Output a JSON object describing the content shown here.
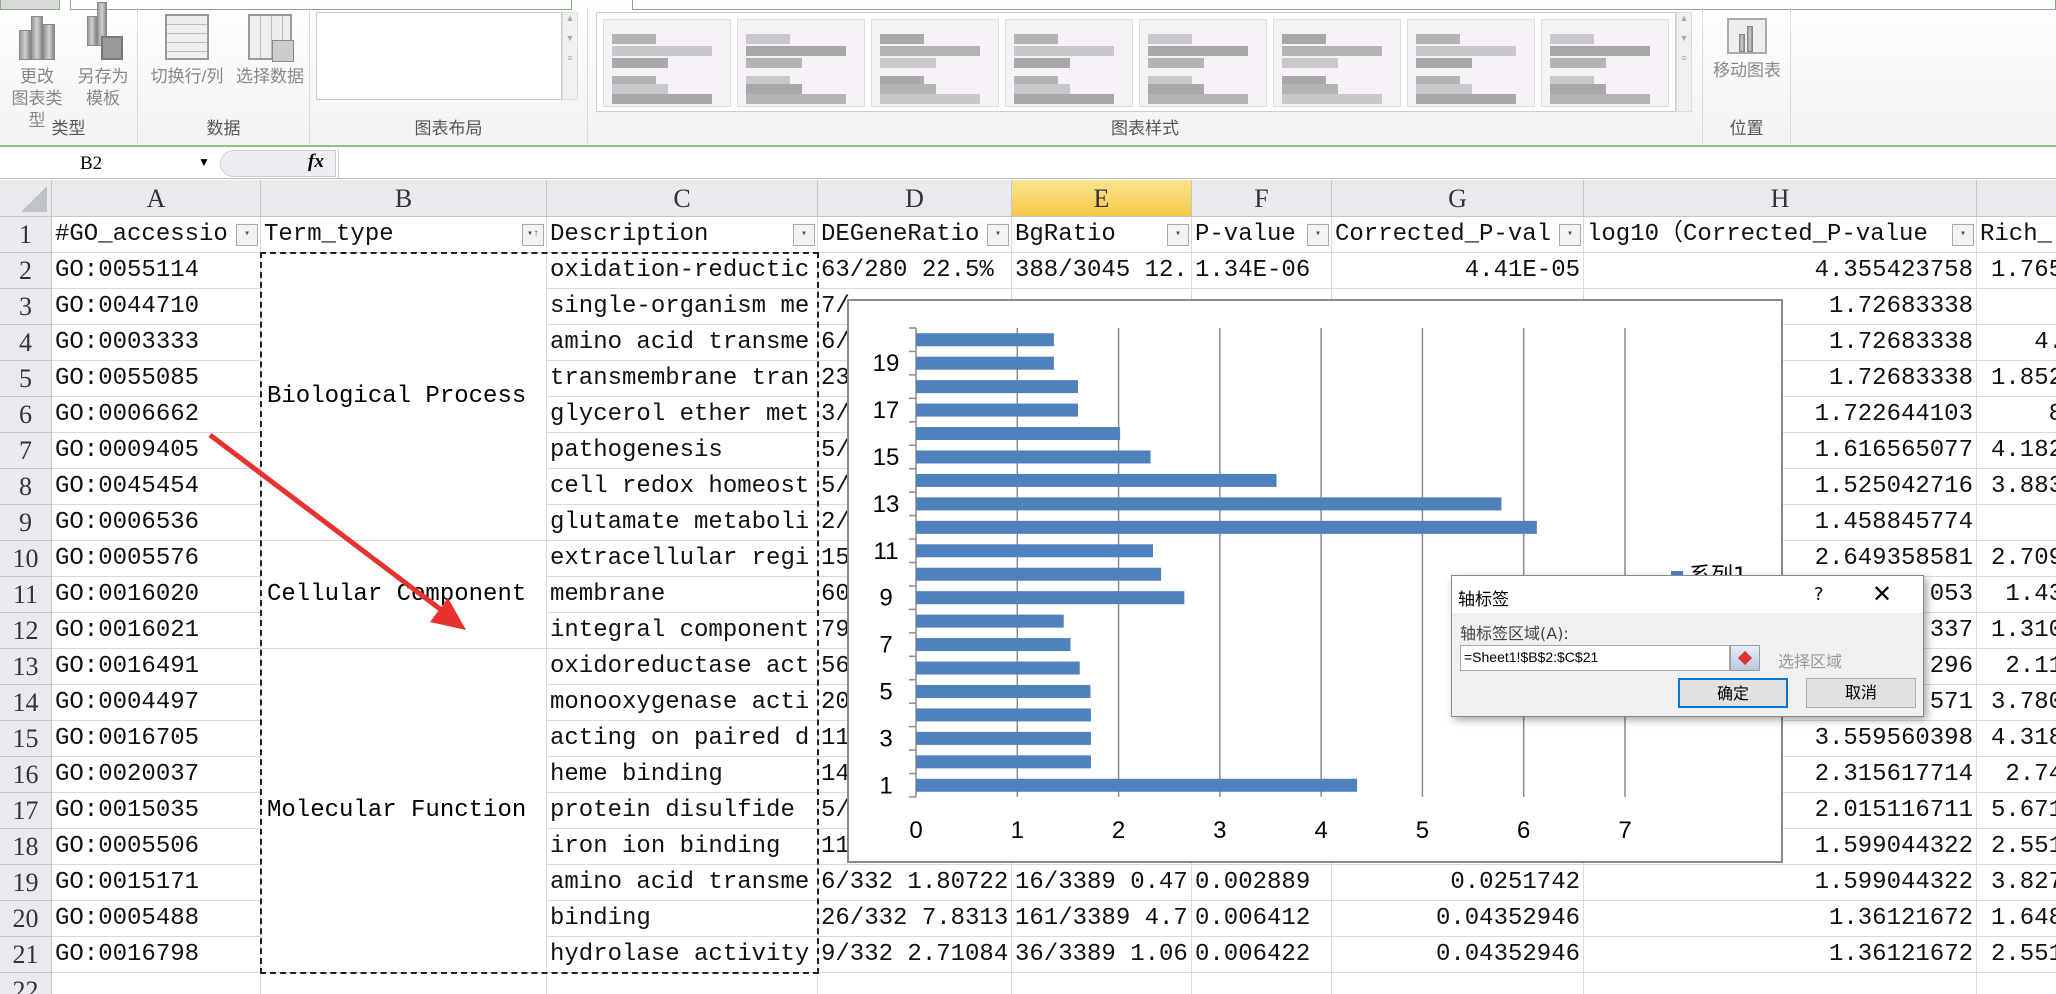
{
  "ribbon": {
    "groups": [
      {
        "label": "类型",
        "buttons": [
          {
            "line1": "更改",
            "line2": "图表类型",
            "icon": "chart-type-icon"
          },
          {
            "line1": "另存为",
            "line2": "模板",
            "icon": "save-template-icon"
          }
        ]
      },
      {
        "label": "数据",
        "buttons": [
          {
            "line1": "切换行/列",
            "line2": "",
            "icon": "switch-row-column-icon"
          },
          {
            "line1": "选择数据",
            "line2": "",
            "icon": "select-data-icon"
          }
        ]
      },
      {
        "label": "图表布局"
      },
      {
        "label": "图表样式"
      },
      {
        "label": "位置",
        "buttons": [
          {
            "line1": "移动图表",
            "line2": "",
            "icon": "move-chart-icon"
          }
        ]
      }
    ]
  },
  "formula_bar": {
    "name_box": "B2",
    "fx": "fx",
    "formula": ""
  },
  "columns": [
    "A",
    "B",
    "C",
    "D",
    "E",
    "F",
    "G",
    "H",
    ""
  ],
  "selected_column": "E",
  "header_row": [
    "#GO_accessio",
    "Term_type",
    "Description",
    "DEGeneRatio",
    "BgRatio",
    "P-value",
    "Corrected_P-val",
    "log10（Corrected_P-value",
    "Rich_"
  ],
  "rows": [
    [
      "GO:0055114",
      "oxidation-reductic",
      "63/280 22.5%",
      "388/3045 12.",
      "1.34E-06",
      "4.41E-05",
      "4.355423758",
      "1.765"
    ],
    [
      "GO:0044710",
      "single-organism me",
      "7/",
      "",
      "",
      "",
      "1.72683338",
      ""
    ],
    [
      "GO:0003333",
      "amino acid transme",
      "6/",
      "",
      "",
      "",
      "1.72683338",
      "4."
    ],
    [
      "GO:0055085",
      "transmembrane tran",
      "23",
      "",
      "",
      "",
      "1.72683338",
      "1.852"
    ],
    [
      "GO:0006662",
      "glycerol ether met",
      "3/",
      "",
      "",
      "",
      "1.722644103",
      "8"
    ],
    [
      "GO:0009405",
      "pathogenesis",
      "5/",
      "",
      "",
      "",
      "1.616565077",
      "4.182"
    ],
    [
      "GO:0045454",
      "cell redox homeost",
      "5/",
      "",
      "",
      "",
      "1.525042716",
      "3.883"
    ],
    [
      "GO:0006536",
      "glutamate metaboli",
      "2/",
      "",
      "",
      "",
      "1.458845774",
      ""
    ],
    [
      "GO:0005576",
      "extracellular regi",
      "15",
      "",
      "",
      "",
      "2.649358581",
      "2.709"
    ],
    [
      "GO:0016020",
      "membrane",
      "60",
      "",
      "",
      "",
      "053",
      "1.43"
    ],
    [
      "GO:0016021",
      "integral component",
      "79",
      "",
      "",
      "",
      "337",
      "1.310"
    ],
    [
      "GO:0016491",
      "oxidoreductase act",
      "56",
      "",
      "",
      "",
      "296",
      "2.11"
    ],
    [
      "GO:0004497",
      "monooxygenase acti",
      "20",
      "",
      "",
      "",
      "571",
      "3.780"
    ],
    [
      "GO:0016705",
      "acting on paired d",
      "11",
      "",
      "",
      "",
      "3.559560398",
      "4.318"
    ],
    [
      "GO:0020037",
      "heme binding",
      "14",
      "",
      "",
      "",
      "2.315617714",
      "2.74"
    ],
    [
      "GO:0015035",
      "protein disulfide",
      "5/",
      "",
      "",
      "",
      "2.015116711",
      "5.671"
    ],
    [
      "GO:0005506",
      "iron ion binding",
      "11",
      "",
      "",
      "",
      "1.599044322",
      "2.551"
    ],
    [
      "GO:0015171",
      "amino acid transme",
      "6/332 1.80722",
      "16/3389 0.47",
      "0.002889",
      "0.0251742",
      "1.599044322",
      "3.827"
    ],
    [
      "GO:0005488",
      "binding",
      "26/332 7.8313",
      "161/3389 4.7",
      "0.006412",
      "0.04352946",
      "1.36121672",
      "1.648"
    ],
    [
      "GO:0016798",
      "hydrolase activity",
      "9/332 2.71084",
      "36/3389 1.06",
      "0.006422",
      "0.04352946",
      "1.36121672",
      "2.551"
    ]
  ],
  "term_groups": [
    {
      "label": "Biological Process",
      "span": 8
    },
    {
      "label": "Cellular Component",
      "span": 3
    },
    {
      "label": "Molecular Function",
      "span": 9
    }
  ],
  "chart_data": {
    "type": "bar",
    "orientation": "horizontal",
    "categories": [
      "1",
      "2",
      "3",
      "4",
      "5",
      "6",
      "7",
      "8",
      "9",
      "10",
      "11",
      "12",
      "13",
      "14",
      "15",
      "16",
      "17",
      "18",
      "19",
      "20"
    ],
    "series": [
      {
        "name": "系列1",
        "values": [
          4.355423758,
          1.72683338,
          1.72683338,
          1.72683338,
          1.722644103,
          1.616565077,
          1.525042716,
          1.458845774,
          2.649358581,
          2.42,
          2.34,
          6.13,
          5.78,
          3.559560398,
          2.315617714,
          2.015116711,
          1.599044322,
          1.599044322,
          1.36121672,
          1.36121672
        ]
      }
    ],
    "y_tick_labels": [
      "1",
      "3",
      "5",
      "7",
      "9",
      "11",
      "13",
      "15",
      "17",
      "19"
    ],
    "x_tick_labels": [
      "0",
      "1",
      "2",
      "3",
      "4",
      "5",
      "6",
      "7"
    ],
    "xlim": [
      0,
      7
    ],
    "grid": "vertical",
    "legend": "right",
    "legend_label": "系列1",
    "color": "#4f81bd"
  },
  "dialog": {
    "title": "轴标签",
    "help": "?",
    "close": "✕",
    "field_label": "轴标签区域(A):",
    "field_value": "=Sheet1!$B$2:$C$21",
    "select_range": "选择区域",
    "ok": "确定",
    "cancel": "取消"
  },
  "colors": {
    "accent": "#4f81bd",
    "arrow": "#e8322f",
    "selected_header": "#f8d36a"
  }
}
